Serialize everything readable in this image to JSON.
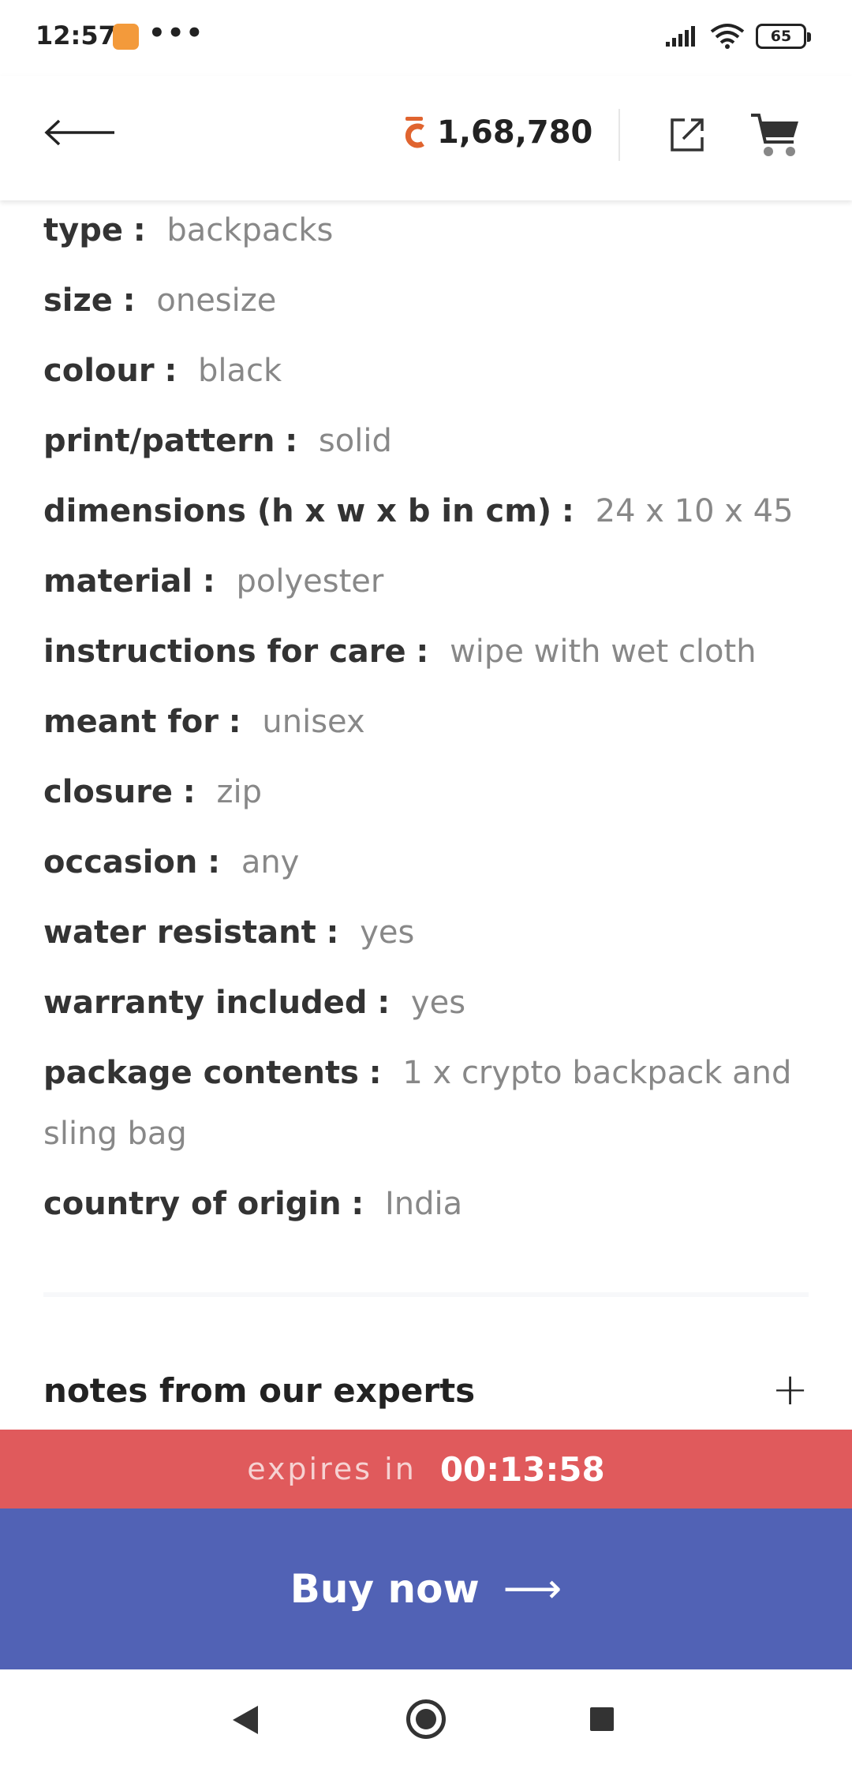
{
  "status_bar": {
    "time": "12:57",
    "dots": "•••",
    "battery": "65"
  },
  "header": {
    "coin_icon": "coin-icon",
    "coin_balance": "1,68,780"
  },
  "details": [
    {
      "label": "type",
      "value": "backpacks"
    },
    {
      "label": "size",
      "value": "onesize"
    },
    {
      "label": "colour",
      "value": "black"
    },
    {
      "label": "print/pattern",
      "value": "solid"
    },
    {
      "label": "dimensions (h x w x b in cm)",
      "value": "24 x 10 x 45"
    },
    {
      "label": "material",
      "value": "polyester"
    },
    {
      "label": "instructions for care",
      "value": "wipe with wet cloth"
    },
    {
      "label": "meant for",
      "value": "unisex"
    },
    {
      "label": "closure",
      "value": "zip"
    },
    {
      "label": "occasion",
      "value": "any"
    },
    {
      "label": "water resistant",
      "value": "yes"
    },
    {
      "label": "warranty included",
      "value": "yes"
    },
    {
      "label": "package contents",
      "value": "1 x crypto backpack and sling bag"
    },
    {
      "label": "country of origin",
      "value": "India"
    }
  ],
  "separator": ":",
  "experts": {
    "title": "notes from our experts",
    "expand_icon": "+"
  },
  "cta": {
    "expiry_label": "expires in",
    "expiry_timer": "00:13:58",
    "buy_label": "Buy now",
    "buy_arrow": "⟶"
  },
  "colors": {
    "coin": "#e0642f",
    "expiry_bar": "#e05a5c",
    "buy_bar": "#5162b5"
  }
}
